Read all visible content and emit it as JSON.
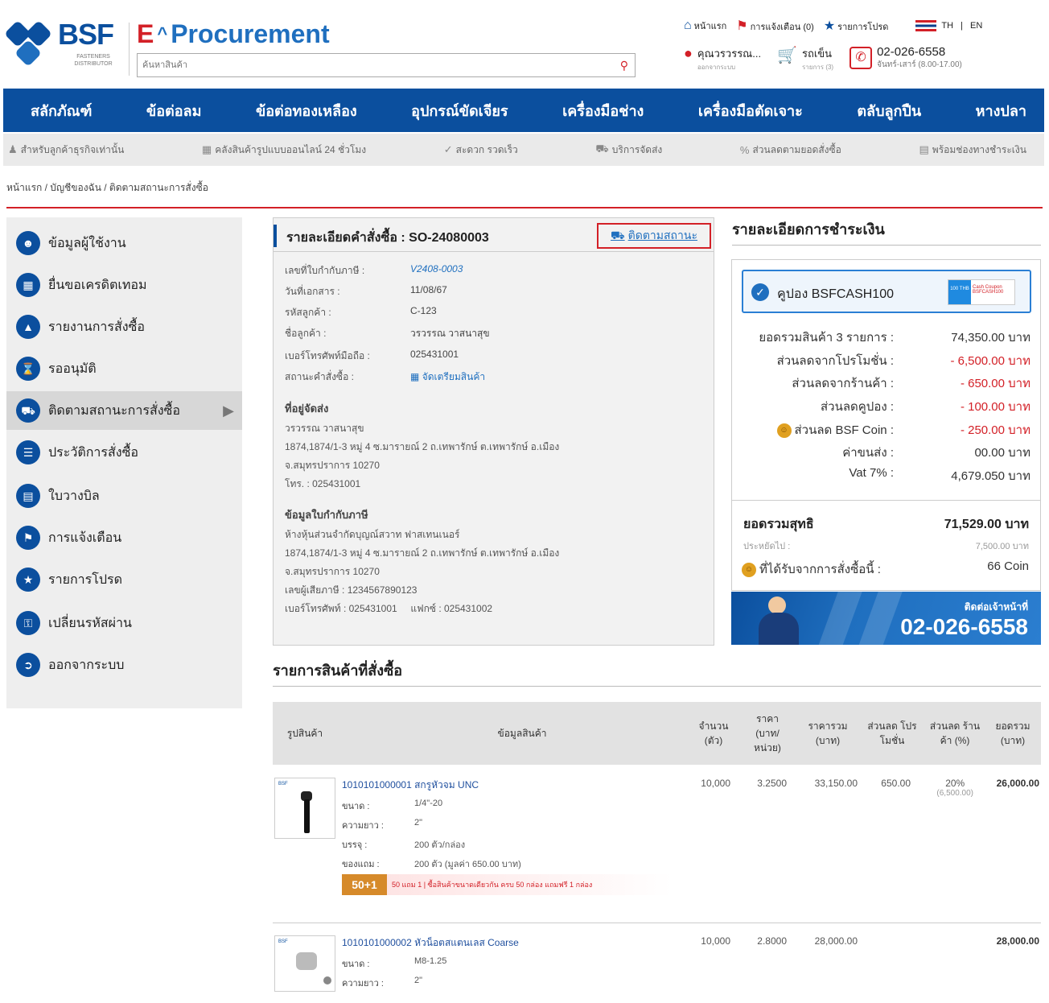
{
  "brand": {
    "name": "BSF",
    "sub": "FASTENERS DISTRIBUTOR",
    "eproc_e": "E",
    "eproc_rest": "Procurement"
  },
  "search": {
    "placeholder": "ค้นหาสินค้า"
  },
  "toplinks": {
    "home": "หน้าแรก",
    "notify": "การแจ้งเตือน (0)",
    "fav": "รายการโปรด",
    "lang_th": "TH",
    "lang_sep": "|",
    "lang_en": "EN"
  },
  "user": {
    "name": "คุณวรวรรณ...",
    "sub": "ออกจากระบบ",
    "cart": "รถเข็น",
    "cart_sub": "รายการ (3)",
    "phone": "02-026-6558",
    "hours": "จันทร์-เสาร์ (8.00-17.00)"
  },
  "mainnav": [
    "สลักภัณฑ์",
    "ข้อต่อลม",
    "ข้อต่อทองเหลือง",
    "อุปกรณ์ขัดเจียร",
    "เครื่องมือช่าง",
    "เครื่องมือตัดเจาะ",
    "ตลับลูกปืน",
    "หางปลา"
  ],
  "subnav": [
    "สำหรับลูกค้าธุรกิจเท่านั้น",
    "คลังสินค้ารูปแบบออนไลน์ 24 ชั่วโมง",
    "สะดวก รวดเร็ว",
    "บริการจัดส่ง",
    "ส่วนลดตามยอดสั่งซื้อ",
    "พร้อมช่องทางชำระเงิน"
  ],
  "breadcrumb": "หน้าแรก / บัญชีของฉัน / ติดตามสถานะการสั่งซื้อ",
  "sidebar": [
    {
      "label": "ข้อมูลผู้ใช้งาน",
      "icon": "user-icon"
    },
    {
      "label": "ยื่นขอเครดิตเทอม",
      "icon": "calendar-icon"
    },
    {
      "label": "รายงานการสั่งซื้อ",
      "icon": "chart-icon"
    },
    {
      "label": "รออนุมัติ",
      "icon": "hourglass-icon"
    },
    {
      "label": "ติดตามสถานะการสั่งซื้อ",
      "icon": "truck-icon"
    },
    {
      "label": "ประวัติการสั่งซื้อ",
      "icon": "list-icon"
    },
    {
      "label": "ใบวางบิล",
      "icon": "bill-icon"
    },
    {
      "label": "การแจ้งเตือน",
      "icon": "bell-icon"
    },
    {
      "label": "รายการโปรด",
      "icon": "star-icon"
    },
    {
      "label": "เปลี่ยนรหัสผ่าน",
      "icon": "lock-icon"
    },
    {
      "label": "ออกจากระบบ",
      "icon": "logout-icon"
    }
  ],
  "detail": {
    "title": "รายละเอียดคำสั่งซื้อ : SO-24080003",
    "track": "ติดตามสถานะ",
    "fields": [
      {
        "k": "เลขที่ใบกำกับภาษี :",
        "v": "V2408-0003"
      },
      {
        "k": "วันที่เอกสาร :",
        "v": "11/08/67"
      },
      {
        "k": "รหัสลูกค้า :",
        "v": "C-123"
      },
      {
        "k": "ชื่อลูกค้า :",
        "v": "วรวรรณ วาสนาสุข"
      },
      {
        "k": "เบอร์โทรศัพท์มือถือ :",
        "v": "025431001"
      },
      {
        "k": "สถานะคำสั่งซื้อ :",
        "v": "จัดเตรียมสินค้า"
      }
    ],
    "ship_title": "ที่อยู่จัดส่ง",
    "ship": [
      "วรวรรณ วาสนาสุข",
      "1874,1874/1-3 หมู่ 4 ซ.มารายณ์ 2 ถ.เทพารักษ์ ต.เทพารักษ์ อ.เมือง",
      "จ.สมุทรปราการ 10270",
      "โทร. : 025431001"
    ],
    "tax_title": "ข้อมูลใบกำกับภาษี",
    "tax": [
      "ห้างหุ้นส่วนจำกัดบุญณ์สวาท ฟาสเทนเนอร์",
      "1874,1874/1-3 หมู่ 4 ซ.มารายณ์ 2 ถ.เทพารักษ์ ต.เทพารักษ์ อ.เมือง",
      "จ.สมุทรปราการ 10270",
      "เลขผู้เสียภาษี : 1234567890123",
      "เบอร์โทรศัพท์ : 025431001     แฟกซ์ : 025431002"
    ]
  },
  "payment": {
    "title": "รายละเอียดการชำระเงิน",
    "coupon": "คูปอง BSFCASH100",
    "coupon_img_left": "100 THB",
    "coupon_img_right": "Cash Coupon BSFCASH100",
    "rows": [
      {
        "k": "ยอดรวมสินค้า 3 รายการ :",
        "v": "74,350.00 บาท",
        "red": false
      },
      {
        "k": "ส่วนลดจากโปรโมชั่น :",
        "v": "- 6,500.00 บาท",
        "red": true
      },
      {
        "k": "ส่วนลดจากร้านค้า :",
        "v": "- 650.00 บาท",
        "red": true
      },
      {
        "k": "ส่วนลดคูปอง :",
        "v": "- 100.00 บาท",
        "red": true
      },
      {
        "k": "ส่วนลด BSF Coin :",
        "v": "- 250.00 บาท",
        "red": true
      },
      {
        "k": "ค่าขนส่ง :",
        "v": "00.00 บาท",
        "red": false
      },
      {
        "k": "Vat 7% :",
        "v": "4,679.050 บาท",
        "red": false
      }
    ],
    "net_label": "ยอดรวมสุทธิ",
    "net_value": "71,529.00 บาท",
    "save_label": "ประหยัดไป :",
    "save_value": "7,500.00 บาท",
    "coin_label": "ที่ได้รับจากการสั่งซื้อนี้ :",
    "coin_value": "66 Coin"
  },
  "contact": {
    "label": "ติดต่อเจ้าหน้าที่",
    "phone": "02-026-6558"
  },
  "products": {
    "title": "รายการสินค้าที่สั่งซื้อ",
    "headers": [
      "รูปสินค้า",
      "ข้อมูลสินค้า",
      "จำนวน (ตัว)",
      "ราคา (บาท/ หน่วย)",
      "ราคารวม (บาท)",
      "ส่วนลด โปรโมชั่น",
      "ส่วนลด ร้านค้า (%)",
      "ยอดรวม (บาท)"
    ],
    "items": [
      {
        "name": "1010101000001 สกรูหัวจม UNC",
        "specs": [
          {
            "k": "ขนาด :",
            "v": "1/4\"-20"
          },
          {
            "k": "ความยาว :",
            "v": "2\""
          },
          {
            "k": "บรรจุ :",
            "v": "200 ตัว/กล่อง"
          },
          {
            "k": "ของแถม :",
            "v": "200 ตัว (มูลค่า 650.00 บาท)"
          }
        ],
        "qty": "10,000",
        "price": "3.2500",
        "total": "33,150.00",
        "promo_disc": "650.00",
        "shop_disc": "20%",
        "shop_disc_sub": "(6,500.00)",
        "grand": "26,000.00",
        "promo_badge": "50+1",
        "promo_text": "50 แถม 1 | ซื้อสินค้าขนาดเดียวกัน ครบ 50 กล่อง แถมฟรี 1 กล่อง"
      },
      {
        "name": "1010101000002 หัวน็อตสแตนเลส Coarse",
        "specs": [
          {
            "k": "ขนาด :",
            "v": "M8-1.25"
          },
          {
            "k": "ความยาว :",
            "v": "2\""
          }
        ],
        "qty": "10,000",
        "price": "2.8000",
        "total": "28,000.00",
        "promo_disc": "",
        "shop_disc": "",
        "shop_disc_sub": "",
        "grand": "28,000.00"
      }
    ]
  },
  "colors": {
    "brand_blue": "#0b4f9e",
    "accent_red": "#d32027",
    "link_blue": "#1f6fbf"
  }
}
